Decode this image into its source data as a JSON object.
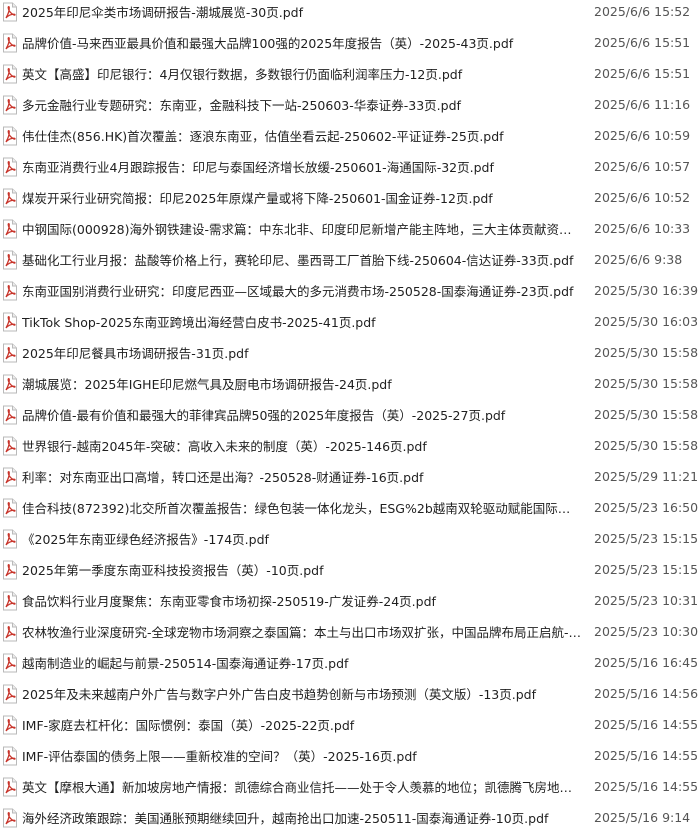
{
  "colors": {
    "icon_red": "#c8352b",
    "text": "#1f1f1f",
    "date_text": "#555555"
  },
  "files": [
    {
      "icon": "pdf-file-icon",
      "name": "2025年印尼伞类市场调研报告-潮城展览-30页.pdf",
      "date": "2025/6/6 15:52"
    },
    {
      "icon": "pdf-file-icon",
      "name": "品牌价值-马来西亚最具价值和最强大品牌100强的2025年度报告（英）-2025-43页.pdf",
      "date": "2025/6/6 15:51"
    },
    {
      "icon": "pdf-file-icon",
      "name": "英文【高盛】印尼银行：4月仅银行数据，多数银行仍面临利润率压力-12页.pdf",
      "date": "2025/6/6 15:51"
    },
    {
      "icon": "pdf-file-icon",
      "name": "多元金融行业专题研究：东南亚，金融科技下一站-250603-华泰证券-33页.pdf",
      "date": "2025/6/6 11:16"
    },
    {
      "icon": "pdf-file-icon",
      "name": "伟仕佳杰(856.HK)首次覆盖：逐浪东南亚，估值坐看云起-250602-平证证券-25页.pdf",
      "date": "2025/6/6 10:59"
    },
    {
      "icon": "pdf-file-icon",
      "name": "东南亚消费行业4月跟踪报告：印尼与泰国经济增长放缓-250601-海通国际-32页.pdf",
      "date": "2025/6/6 10:57"
    },
    {
      "icon": "pdf-file-icon",
      "name": "煤炭开采行业研究简报：印尼2025年原煤产量或将下降-250601-国金证券-12页.pdf",
      "date": "2025/6/6 10:52"
    },
    {
      "icon": "pdf-file-icon",
      "name": "中钢国际(000928)海外钢铁建设-需求篇：中东北非、印度印尼新增产能主阵地，三大主体贡献资本开支...",
      "date": "2025/6/6 10:33"
    },
    {
      "icon": "pdf-file-icon",
      "name": "基础化工行业月报：盐酸等价格上行，赛轮印尼、墨西哥工厂首胎下线-250604-信达证券-33页.pdf",
      "date": "2025/6/6 9:38"
    },
    {
      "icon": "pdf-file-icon",
      "name": "东南亚国别消费行业研究：印度尼西亚—区域最大的多元消费市场-250528-国泰海通证券-23页.pdf",
      "date": "2025/5/30 16:39"
    },
    {
      "icon": "pdf-file-icon",
      "name": "TikTok Shop-2025东南亚跨境出海经营白皮书-2025-41页.pdf",
      "date": "2025/5/30 16:03"
    },
    {
      "icon": "pdf-file-icon",
      "name": "2025年印尼餐具市场调研报告-31页.pdf",
      "date": "2025/5/30 15:58"
    },
    {
      "icon": "pdf-file-icon",
      "name": "潮城展览：2025年IGHE印尼燃气具及厨电市场调研报告-24页.pdf",
      "date": "2025/5/30 15:58"
    },
    {
      "icon": "pdf-file-icon",
      "name": "品牌价值-最有价值和最强大的菲律宾品牌50强的2025年度报告（英）-2025-27页.pdf",
      "date": "2025/5/30 15:58"
    },
    {
      "icon": "pdf-file-icon",
      "name": "世界银行-越南2045年-突破：高收入未来的制度（英）-2025-146页.pdf",
      "date": "2025/5/30 15:58"
    },
    {
      "icon": "pdf-file-icon",
      "name": "利率：对东南亚出口高增，转口还是出海？-250528-财通证券-16页.pdf",
      "date": "2025/5/29 11:21"
    },
    {
      "icon": "pdf-file-icon",
      "name": "佳合科技(872392)北交所首次覆盖报告：绿色包装一体化龙头，ESG%2b越南双轮驱动赋能国际品牌一...",
      "date": "2025/5/23 16:50"
    },
    {
      "icon": "pdf-file-icon",
      "name": "《2025年东南亚绿色经济报告》-174页.pdf",
      "date": "2025/5/23 15:15"
    },
    {
      "icon": "pdf-file-icon",
      "name": "2025年第一季度东南亚科技投资报告（英）-10页.pdf",
      "date": "2025/5/23 15:15"
    },
    {
      "icon": "pdf-file-icon",
      "name": "食品饮料行业月度聚焦：东南亚零食市场初探-250519-广发证券-24页.pdf",
      "date": "2025/5/23 10:31"
    },
    {
      "icon": "pdf-file-icon",
      "name": "农林牧渔行业深度研究-全球宠物市场洞察之泰国篇：本土与出口市场双扩张，中国品牌布局正启航-250...",
      "date": "2025/5/23 10:30"
    },
    {
      "icon": "pdf-file-icon",
      "name": "越南制造业的崛起与前景-250514-国泰海通证券-17页.pdf",
      "date": "2025/5/16 16:45"
    },
    {
      "icon": "pdf-file-icon",
      "name": "2025年及未来越南户外广告与数字户外广告白皮书趋势创新与市场预测（英文版）-13页.pdf",
      "date": "2025/5/16 14:56"
    },
    {
      "icon": "pdf-file-icon",
      "name": "IMF-家庭去杠杆化：国际惯例：泰国（英）-2025-22页.pdf",
      "date": "2025/5/16 14:55"
    },
    {
      "icon": "pdf-file-icon",
      "name": "IMF-评估泰国的债务上限——重新校准的空间？（英）-2025-16页.pdf",
      "date": "2025/5/16 14:55"
    },
    {
      "icon": "pdf-file-icon",
      "name": "英文【摩根大通】新加坡房地产情报：凯德综合商业信托——处于令人羡慕的地位；凯德腾飞房地产投...",
      "date": "2025/5/16 14:55"
    },
    {
      "icon": "pdf-file-icon",
      "name": "海外经济政策跟踪：美国通胀预期继续回升，越南抢出口加速-250511-国泰海通证券-10页.pdf",
      "date": "2025/5/16 9:14"
    }
  ]
}
